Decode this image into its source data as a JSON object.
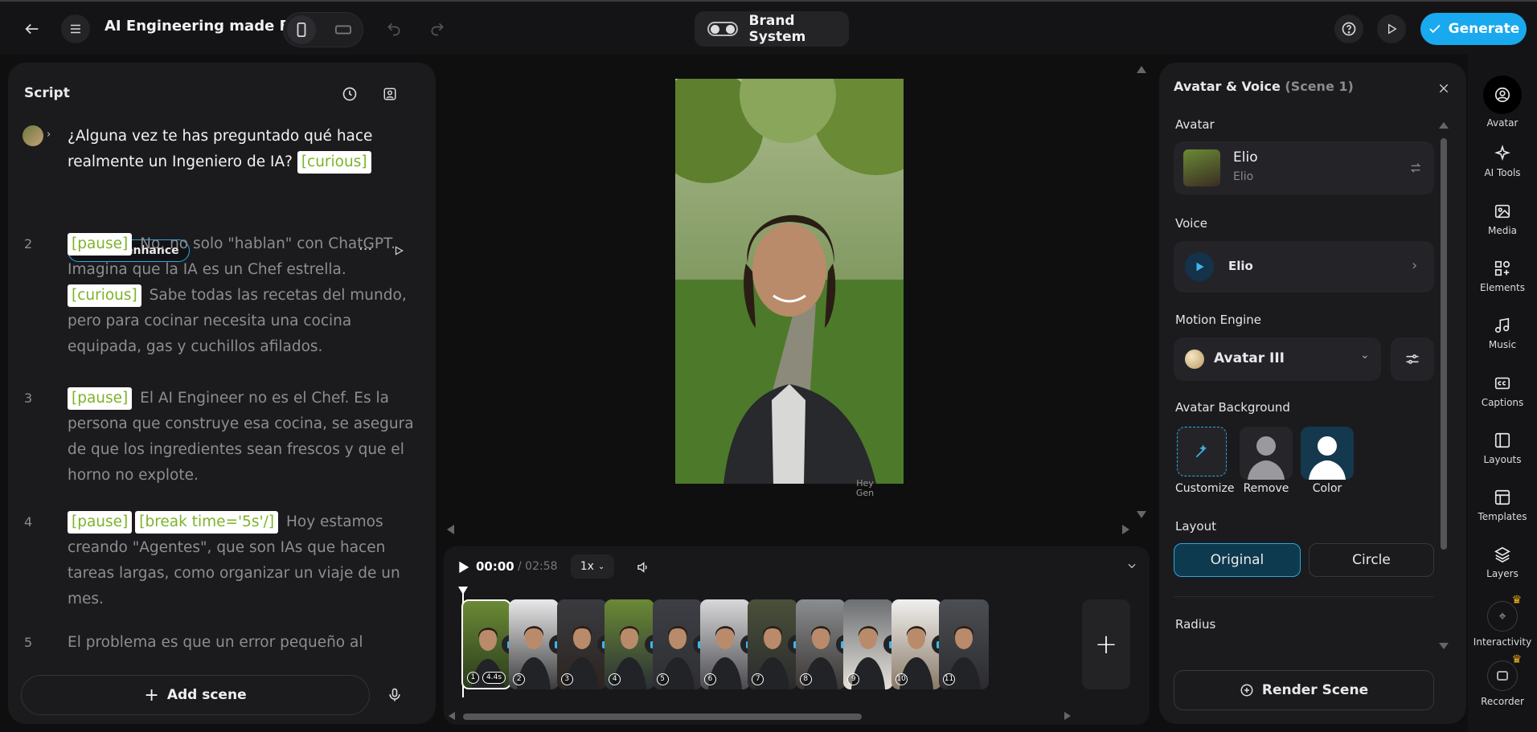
{
  "topbar": {
    "project_title": "AI Engineering made Easy",
    "brand_label": "Brand System",
    "generate_label": "Generate"
  },
  "script": {
    "title": "Script",
    "scenes": [
      {
        "num": "",
        "active": true,
        "parts": [
          {
            "type": "text",
            "value": "¿Alguna vez te has preguntado qué hace realmente un Ingeniero de IA? "
          },
          {
            "type": "tag",
            "value": "[curious]"
          }
        ]
      },
      {
        "num": "2",
        "parts": [
          {
            "type": "tag",
            "value": "[pause]"
          },
          {
            "type": "text",
            "value": " No, no solo \"hablan\" con ChatGPT. Imagina que la IA es un Chef estrella. "
          },
          {
            "type": "tag",
            "value": "[curious]"
          },
          {
            "type": "text",
            "value": " Sabe todas las recetas del mundo, pero para cocinar necesita una cocina equipada, gas y cuchillos afilados."
          }
        ]
      },
      {
        "num": "3",
        "parts": [
          {
            "type": "tag",
            "value": "[pause]"
          },
          {
            "type": "text",
            "value": " El AI Engineer no es el Chef. Es la persona que construye esa cocina, se asegura de que los ingredientes sean frescos y que el horno no explote."
          }
        ]
      },
      {
        "num": "4",
        "parts": [
          {
            "type": "tag",
            "value": "[pause]"
          },
          {
            "type": "tag",
            "value": "[break time='5s'/]"
          },
          {
            "type": "text",
            "value": " Hoy estamos creando \"Agentes\", que son IAs que hacen tareas largas, como organizar un viaje de un mes."
          }
        ]
      },
      {
        "num": "5",
        "parts": [
          {
            "type": "text",
            "value": "El problema es que un error pequeño al"
          }
        ]
      }
    ],
    "auto_enhance_label": "Auto-enhance",
    "add_scene_label": "Add scene"
  },
  "preview": {
    "watermark": "Hey Gen"
  },
  "timeline": {
    "current_time": "00:00",
    "total_time": "/ 02:58",
    "speed": "1x",
    "first_duration": "4.4s",
    "thumbs": [
      "1",
      "2",
      "3",
      "4",
      "5",
      "6",
      "7",
      "8",
      "9",
      "10",
      "11"
    ]
  },
  "panel": {
    "title": "Avatar & Voice",
    "scene_tag": "(Scene 1)",
    "avatar_label": "Avatar",
    "avatar_name": "Elio",
    "avatar_sub": "Elio",
    "voice_label": "Voice",
    "voice_name": "Elio",
    "motion_label": "Motion Engine",
    "motion_value": "Avatar III",
    "bg_label": "Avatar Background",
    "bg_options": [
      "Customize",
      "Remove",
      "Color"
    ],
    "layout_label": "Layout",
    "layout_original": "Original",
    "layout_circle": "Circle",
    "radius_label": "Radius",
    "render_label": "Render Scene"
  },
  "rail": {
    "items": [
      "Avatar",
      "AI Tools",
      "Media",
      "Elements",
      "Music",
      "Captions",
      "Layouts",
      "Templates",
      "Layers",
      "Interactivity",
      "Recorder"
    ]
  },
  "colors": {
    "accent": "#19a9ee",
    "tag_text": "#7cb32a",
    "selected_layout": "#0d3a4e"
  }
}
